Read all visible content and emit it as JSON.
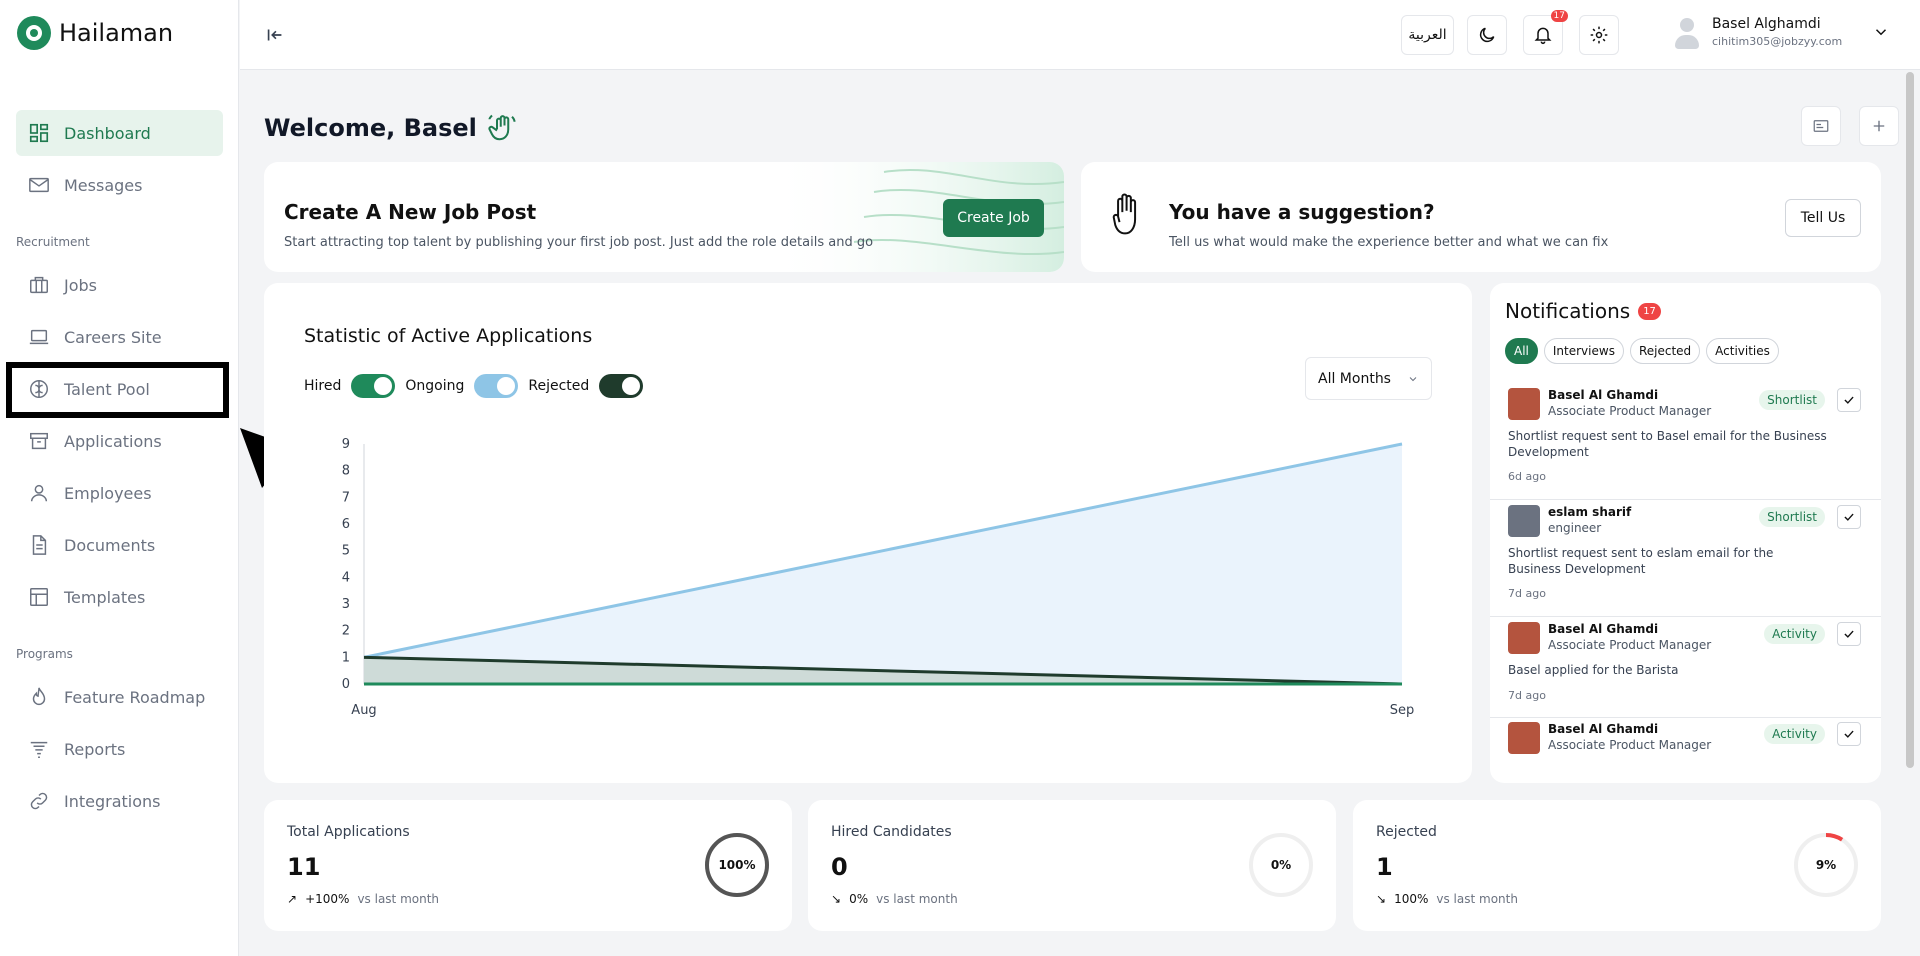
{
  "brand": {
    "name": "Hailaman",
    "accent": "#1f7a50"
  },
  "sidebar": {
    "items": [
      {
        "label": "Dashboard",
        "icon": "dashboard-icon",
        "active": true
      },
      {
        "label": "Messages",
        "icon": "mail-icon"
      }
    ],
    "section_recruitment": "Recruitment",
    "recruitment_items": [
      {
        "label": "Jobs",
        "icon": "briefcase-icon"
      },
      {
        "label": "Careers Site",
        "icon": "laptop-icon"
      },
      {
        "label": "Talent Pool",
        "icon": "brain-icon"
      },
      {
        "label": "Applications",
        "icon": "archive-icon"
      },
      {
        "label": "Employees",
        "icon": "person-icon"
      },
      {
        "label": "Documents",
        "icon": "document-icon"
      },
      {
        "label": "Templates",
        "icon": "template-icon"
      }
    ],
    "section_programs": "Programs",
    "program_items": [
      {
        "label": "Feature Roadmap",
        "icon": "flame-icon"
      },
      {
        "label": "Reports",
        "icon": "filter-lines-icon"
      },
      {
        "label": "Integrations",
        "icon": "link-icon"
      }
    ]
  },
  "header": {
    "language": "العربية",
    "notification_count": "17",
    "user_name": "Basel Alghamdi",
    "user_email": "cihitim305@jobzyy.com"
  },
  "main": {
    "welcome": "Welcome, Basel",
    "job_card": {
      "title": "Create A New Job Post",
      "subtitle": "Start attracting top talent by publishing your first job post. Just add the role details and go",
      "button": "Create Job"
    },
    "suggest_card": {
      "title": "You have a suggestion?",
      "subtitle": "Tell us what would make the experience better and what we can fix",
      "button": "Tell Us"
    },
    "stats_card": {
      "title": "Statistic of Active Applications",
      "legend": {
        "hired": "Hired",
        "ongoing": "Ongoing",
        "rejected": "Rejected"
      },
      "select": "All Months"
    },
    "notifications": {
      "title": "Notifications",
      "count": "17",
      "filters": [
        "All",
        "Interviews",
        "Rejected",
        "Activities"
      ],
      "items": [
        {
          "name": "Basel Al Ghamdi",
          "role": "Associate Product Manager",
          "tag": "Shortlist",
          "text": "Shortlist request sent to Basel email for the Business Development",
          "time": "6d ago"
        },
        {
          "name": "eslam sharif",
          "role": "engineer",
          "tag": "Shortlist",
          "text": "Shortlist request sent to eslam email for the Business Development",
          "time": "7d ago"
        },
        {
          "name": "Basel Al Ghamdi",
          "role": "Associate Product Manager",
          "tag": "Activity",
          "text": "Basel applied for the Barista",
          "time": "7d ago"
        },
        {
          "name": "Basel Al Ghamdi",
          "role": "Associate Product Manager",
          "tag": "Activity",
          "text": "",
          "time": ""
        }
      ]
    },
    "stats": [
      {
        "label": "Total Applications",
        "value": "11",
        "change": "+100%",
        "period": "vs last month",
        "ring": "100%",
        "pct": 100
      },
      {
        "label": "Hired Candidates",
        "value": "0",
        "change": "0%",
        "period": "vs last month",
        "ring": "0%",
        "pct": 0
      },
      {
        "label": "Rejected",
        "value": "1",
        "change": "100%",
        "period": "vs last month",
        "ring": "9%",
        "pct": 9
      }
    ]
  },
  "chart_data": {
    "type": "area",
    "categories": [
      "Aug",
      "Sep"
    ],
    "ylim": [
      0,
      9
    ],
    "yticks": [
      "0",
      "1",
      "2",
      "3",
      "4",
      "5",
      "6",
      "7",
      "8",
      "9"
    ],
    "series": [
      {
        "name": "Ongoing",
        "values": [
          1,
          9
        ],
        "color": "#8ec5e6"
      },
      {
        "name": "Rejected",
        "values": [
          1,
          0
        ],
        "color": "#1f3b2c"
      },
      {
        "name": "Hired",
        "values": [
          0,
          0
        ],
        "color": "#1f8a5b"
      }
    ]
  }
}
